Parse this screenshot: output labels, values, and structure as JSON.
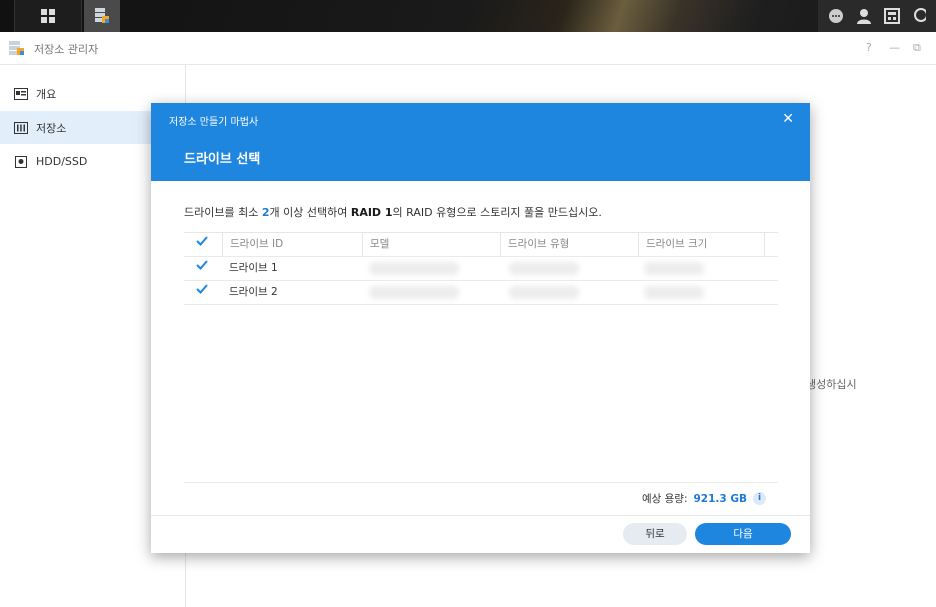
{
  "window": {
    "title": "저장소 관리자",
    "help": "?",
    "minimize": "—",
    "restore": "⧉"
  },
  "sidebar": {
    "items": [
      {
        "label": "개요",
        "icon": "overview-icon"
      },
      {
        "label": "저장소",
        "icon": "storage-icon",
        "active": true
      },
      {
        "label": "HDD/SSD",
        "icon": "hdd-icon"
      }
    ]
  },
  "background_text": "생성하십시",
  "wizard": {
    "title": "저장소 만들기 마법사",
    "step": "드라이브 선택",
    "close": "✕",
    "instruction": {
      "pre": "드라이브를 최소 ",
      "count": "2",
      "mid": "개 이상 선택하여 ",
      "raid": "RAID 1",
      "post": "의 RAID 유형으로 스토리지 풀을 만드십시오."
    },
    "columns": [
      "드라이브 ID",
      "모델",
      "드라이브 유형",
      "드라이브 크기"
    ],
    "rows": [
      {
        "id": "드라이브 1",
        "checked": true
      },
      {
        "id": "드라이브 2",
        "checked": true
      }
    ],
    "capacity_label": "예상 용량:",
    "capacity_value": "921.3 GB",
    "info_icon": "i",
    "back": "뒤로",
    "next": "다음"
  },
  "colors": {
    "accent": "#1f86e0",
    "active_bg": "#e3eefb"
  }
}
